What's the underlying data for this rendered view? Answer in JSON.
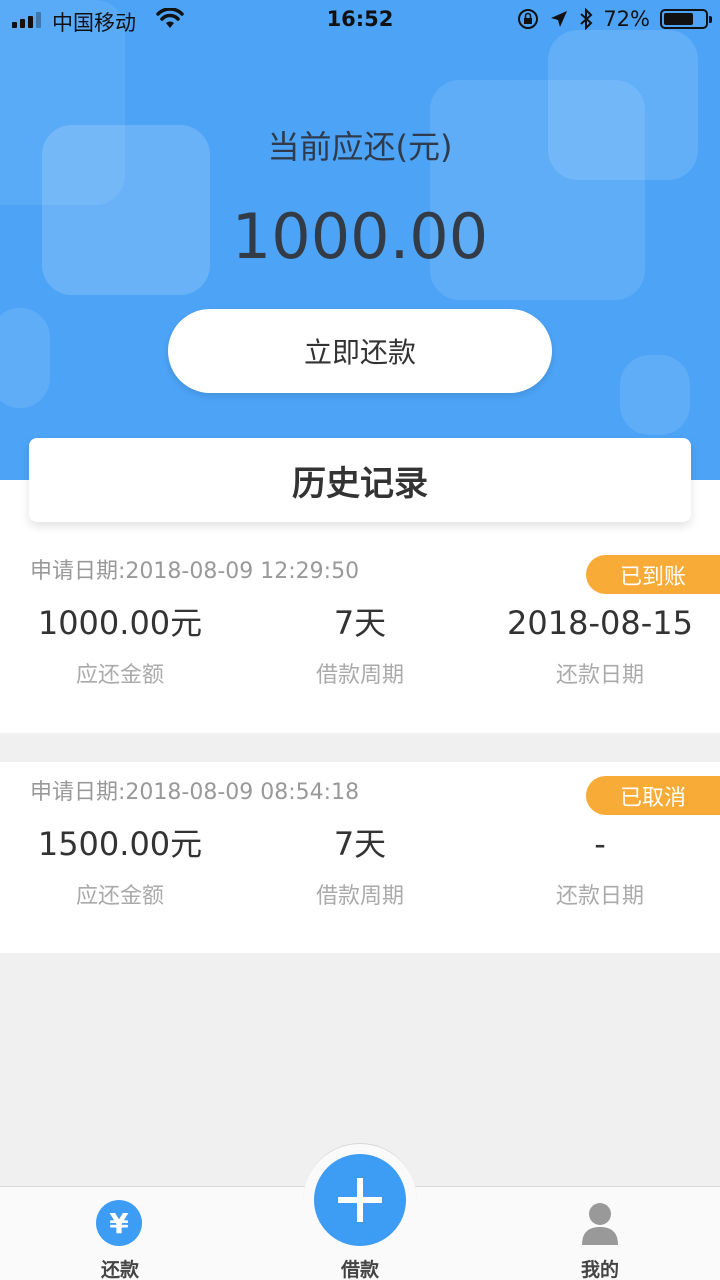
{
  "status_bar": {
    "carrier": "中国移动",
    "time": "16:52",
    "battery": "72%"
  },
  "hero": {
    "label": "当前应还(元)",
    "amount": "1000.00",
    "repay_button": "立即还款"
  },
  "history": {
    "title": "历史记录"
  },
  "records": [
    {
      "apply_date": "申请日期:2018-08-09 12:29:50",
      "status": "已到账",
      "amount": "1000.00元",
      "amount_label": "应还金额",
      "period": "7天",
      "period_label": "借款周期",
      "repay_date": "2018-08-15",
      "repay_date_label": "还款日期"
    },
    {
      "apply_date": "申请日期:2018-08-09 08:54:18",
      "status": "已取消",
      "amount": "1500.00元",
      "amount_label": "应还金额",
      "period": "7天",
      "period_label": "借款周期",
      "repay_date": "-",
      "repay_date_label": "还款日期"
    }
  ],
  "nav": {
    "repay": "还款",
    "borrow": "借款",
    "mine": "我的"
  },
  "colors": {
    "hero_blue": "#4da4f7",
    "accent_blue": "#3d9cf3",
    "badge_orange": "#f8ac37"
  }
}
